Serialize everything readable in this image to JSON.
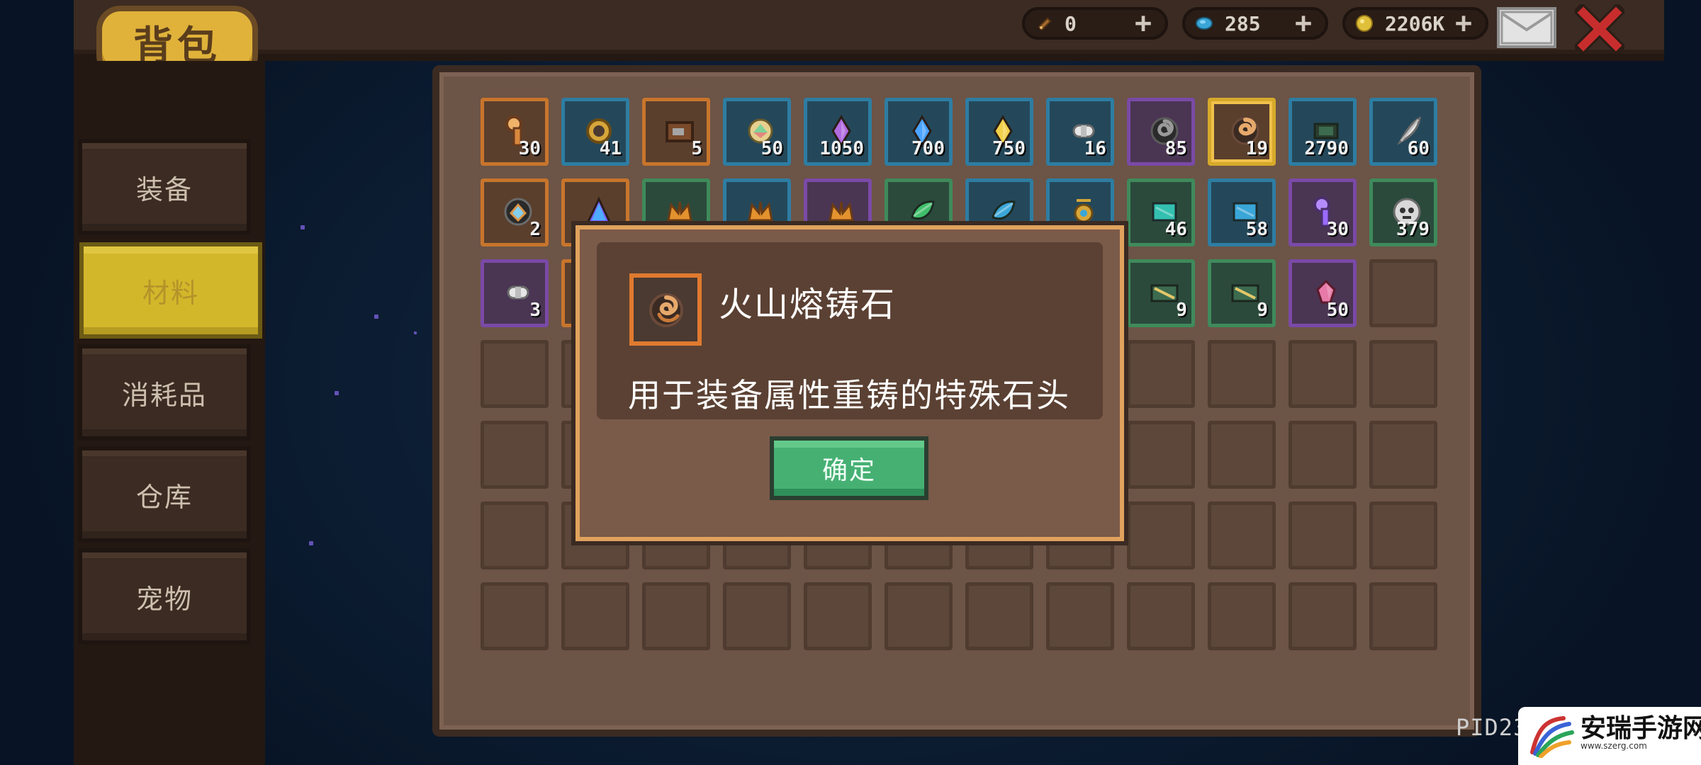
{
  "header": {
    "title": "背包",
    "resources": [
      {
        "name": "ticket",
        "value": "0",
        "icon": "ticket-icon",
        "color": "#a56a2f"
      },
      {
        "name": "gems",
        "value": "285",
        "icon": "gem-icon",
        "color": "#3aa6d8"
      },
      {
        "name": "gold",
        "value": "2206K",
        "icon": "coin-icon",
        "color": "#e0c03a"
      }
    ]
  },
  "sidebar": {
    "tabs": [
      {
        "label": "装备",
        "active": false
      },
      {
        "label": "材料",
        "active": true
      },
      {
        "label": "消耗品",
        "active": false
      },
      {
        "label": "仓库",
        "active": false
      },
      {
        "label": "宠物",
        "active": false
      }
    ]
  },
  "inventory": {
    "rows": [
      [
        {
          "icon": "key-icon",
          "count": "30",
          "rarity": "orange"
        },
        {
          "icon": "ring-icon",
          "count": "41",
          "rarity": "blue"
        },
        {
          "icon": "box-icon",
          "count": "5",
          "rarity": "orange"
        },
        {
          "icon": "orb-icon",
          "count": "50",
          "rarity": "blue"
        },
        {
          "icon": "purple-crystal-icon",
          "count": "1050",
          "rarity": "blue"
        },
        {
          "icon": "blue-crystal-icon",
          "count": "700",
          "rarity": "blue"
        },
        {
          "icon": "gold-crystal-icon",
          "count": "750",
          "rarity": "blue"
        },
        {
          "icon": "bandage-icon",
          "count": "16",
          "rarity": "blue"
        },
        {
          "icon": "spiral-shell-icon",
          "count": "85",
          "rarity": "purple"
        },
        {
          "icon": "volcano-stone-icon",
          "count": "19",
          "rarity": "selected"
        },
        {
          "icon": "film-icon",
          "count": "2790",
          "rarity": "blue"
        },
        {
          "icon": "feather-icon",
          "count": "60",
          "rarity": "blue"
        }
      ],
      [
        {
          "icon": "rainbow-gem-icon",
          "count": "2",
          "rarity": "orange"
        },
        {
          "icon": "prism-icon",
          "count": "",
          "rarity": "orange"
        },
        {
          "icon": "crown-icon",
          "count": "",
          "rarity": "green"
        },
        {
          "icon": "crown-icon",
          "count": "",
          "rarity": "blue"
        },
        {
          "icon": "crown-icon",
          "count": "",
          "rarity": "purple"
        },
        {
          "icon": "leaf-icon",
          "count": "",
          "rarity": "green"
        },
        {
          "icon": "blue-leaf-icon",
          "count": "",
          "rarity": "blue"
        },
        {
          "icon": "amulet-icon",
          "count": "",
          "rarity": "blue"
        },
        {
          "icon": "teal-scroll-icon",
          "count": "46",
          "rarity": "green"
        },
        {
          "icon": "blue-scroll-icon",
          "count": "58",
          "rarity": "blue"
        },
        {
          "icon": "purple-key-icon",
          "count": "30",
          "rarity": "purple"
        },
        {
          "icon": "skull-orb-icon",
          "count": "379",
          "rarity": "green"
        }
      ],
      [
        {
          "icon": "bandage-icon",
          "count": "3",
          "rarity": "purple"
        },
        {
          "icon": "red-item-icon",
          "count": "",
          "rarity": "orange"
        },
        {
          "icon": "",
          "count": "",
          "rarity": "empty"
        },
        {
          "icon": "",
          "count": "",
          "rarity": "empty"
        },
        {
          "icon": "",
          "count": "",
          "rarity": "empty"
        },
        {
          "icon": "",
          "count": "",
          "rarity": "empty"
        },
        {
          "icon": "",
          "count": "",
          "rarity": "empty"
        },
        {
          "icon": "",
          "count": "",
          "rarity": "empty"
        },
        {
          "icon": "map-icon",
          "count": "9",
          "rarity": "green"
        },
        {
          "icon": "map-icon",
          "count": "9",
          "rarity": "green"
        },
        {
          "icon": "pink-gem-icon",
          "count": "50",
          "rarity": "purple"
        },
        {
          "icon": "",
          "count": "",
          "rarity": "empty"
        }
      ],
      [
        {
          "icon": "",
          "count": "",
          "rarity": "empty"
        },
        {
          "icon": "",
          "count": "",
          "rarity": "empty"
        },
        {
          "icon": "",
          "count": "",
          "rarity": "empty"
        },
        {
          "icon": "",
          "count": "",
          "rarity": "empty"
        },
        {
          "icon": "",
          "count": "",
          "rarity": "empty"
        },
        {
          "icon": "",
          "count": "",
          "rarity": "empty"
        },
        {
          "icon": "",
          "count": "",
          "rarity": "empty"
        },
        {
          "icon": "",
          "count": "",
          "rarity": "empty"
        },
        {
          "icon": "",
          "count": "",
          "rarity": "empty"
        },
        {
          "icon": "",
          "count": "",
          "rarity": "empty"
        },
        {
          "icon": "",
          "count": "",
          "rarity": "empty"
        },
        {
          "icon": "",
          "count": "",
          "rarity": "empty"
        }
      ],
      [
        {
          "icon": "",
          "count": "",
          "rarity": "empty"
        },
        {
          "icon": "",
          "count": "",
          "rarity": "empty"
        },
        {
          "icon": "",
          "count": "",
          "rarity": "empty"
        },
        {
          "icon": "",
          "count": "",
          "rarity": "empty"
        },
        {
          "icon": "",
          "count": "",
          "rarity": "empty"
        },
        {
          "icon": "",
          "count": "",
          "rarity": "empty"
        },
        {
          "icon": "",
          "count": "",
          "rarity": "empty"
        },
        {
          "icon": "",
          "count": "",
          "rarity": "empty"
        },
        {
          "icon": "",
          "count": "",
          "rarity": "empty"
        },
        {
          "icon": "",
          "count": "",
          "rarity": "empty"
        },
        {
          "icon": "",
          "count": "",
          "rarity": "empty"
        },
        {
          "icon": "",
          "count": "",
          "rarity": "empty"
        }
      ],
      [
        {
          "icon": "",
          "count": "",
          "rarity": "empty"
        },
        {
          "icon": "",
          "count": "",
          "rarity": "empty"
        },
        {
          "icon": "",
          "count": "",
          "rarity": "empty"
        },
        {
          "icon": "",
          "count": "",
          "rarity": "empty"
        },
        {
          "icon": "",
          "count": "",
          "rarity": "empty"
        },
        {
          "icon": "",
          "count": "",
          "rarity": "empty"
        },
        {
          "icon": "",
          "count": "",
          "rarity": "empty"
        },
        {
          "icon": "",
          "count": "",
          "rarity": "empty"
        },
        {
          "icon": "",
          "count": "",
          "rarity": "empty"
        },
        {
          "icon": "",
          "count": "",
          "rarity": "empty"
        },
        {
          "icon": "",
          "count": "",
          "rarity": "empty"
        },
        {
          "icon": "",
          "count": "",
          "rarity": "empty"
        }
      ],
      [
        {
          "icon": "",
          "count": "",
          "rarity": "empty"
        },
        {
          "icon": "",
          "count": "",
          "rarity": "empty"
        },
        {
          "icon": "",
          "count": "",
          "rarity": "empty"
        },
        {
          "icon": "",
          "count": "",
          "rarity": "empty"
        },
        {
          "icon": "",
          "count": "",
          "rarity": "empty"
        },
        {
          "icon": "",
          "count": "",
          "rarity": "empty"
        },
        {
          "icon": "",
          "count": "",
          "rarity": "empty"
        },
        {
          "icon": "",
          "count": "",
          "rarity": "empty"
        },
        {
          "icon": "",
          "count": "",
          "rarity": "empty"
        },
        {
          "icon": "",
          "count": "",
          "rarity": "empty"
        },
        {
          "icon": "",
          "count": "",
          "rarity": "empty"
        },
        {
          "icon": "",
          "count": "",
          "rarity": "empty"
        }
      ]
    ]
  },
  "popup": {
    "item_icon": "volcano-stone-icon",
    "title": "火山熔铸石",
    "description": "用于装备属性重铸的特殊石头",
    "confirm_label": "确定"
  },
  "footer": {
    "pid": "PID23"
  },
  "watermark": {
    "text": "安瑞手游网",
    "sub": "www.szerg.com"
  }
}
